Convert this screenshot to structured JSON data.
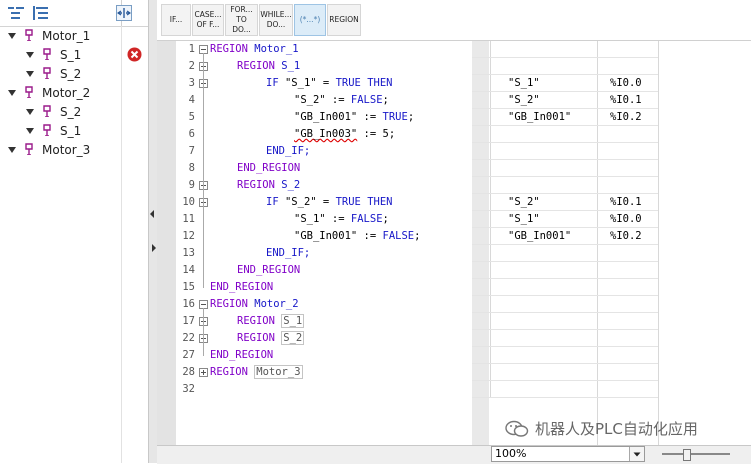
{
  "toolbar": {
    "buttons": [
      {
        "label": "IF..."
      },
      {
        "label": "CASE... OF F..."
      },
      {
        "label": "FOR... TO DO..."
      },
      {
        "label": "WHILE... DO..."
      },
      {
        "label": "(*...*)"
      },
      {
        "label": "REGION"
      }
    ]
  },
  "tree": {
    "items": [
      {
        "label": "Motor_1"
      },
      {
        "label": "S_1"
      },
      {
        "label": "S_2"
      },
      {
        "label": "Motor_2"
      },
      {
        "label": "S_2"
      },
      {
        "label": "S_1"
      },
      {
        "label": "Motor_3"
      }
    ]
  },
  "code": {
    "lines": [
      {
        "n": "1"
      },
      {
        "n": "2"
      },
      {
        "n": "3"
      },
      {
        "n": "4"
      },
      {
        "n": "5"
      },
      {
        "n": "6"
      },
      {
        "n": "7"
      },
      {
        "n": "8"
      },
      {
        "n": "9"
      },
      {
        "n": "10"
      },
      {
        "n": "11"
      },
      {
        "n": "12"
      },
      {
        "n": "13"
      },
      {
        "n": "14"
      },
      {
        "n": "15"
      },
      {
        "n": "16"
      },
      {
        "n": "17"
      },
      {
        "n": "22"
      },
      {
        "n": "27"
      },
      {
        "n": "28"
      },
      {
        "n": "32"
      }
    ],
    "t": {
      "region": "REGION",
      "end_region": "END_REGION",
      "if": "IF",
      "then": "THEN",
      "end_if": "END_IF;",
      "true": "TRUE",
      "false": "FALSE",
      "motor_1": "Motor_1",
      "motor_2": "Motor_2",
      "motor_3": "Motor_3",
      "s_1": "S_1",
      "s_2": "S_2",
      "q_s1": "\"S_1\"",
      "q_s2": "\"S_2\"",
      "q_gb1": "\"GB_In001\"",
      "q_gb3": "\"GB_In003\"",
      "eq": " = ",
      "assign": " := ",
      "semi": ";",
      "five": "5;"
    }
  },
  "xref": {
    "rows": [
      {
        "sym": "\"S_1\"",
        "addr": "%I0.0"
      },
      {
        "sym": "\"S_2\"",
        "addr": "%I0.1"
      },
      {
        "sym": "\"GB_In001\"",
        "addr": "%I0.2"
      },
      {
        "sym": "\"S_2\"",
        "addr": "%I0.1"
      },
      {
        "sym": "\"S_1\"",
        "addr": "%I0.0"
      },
      {
        "sym": "\"GB_In001\"",
        "addr": "%I0.2"
      }
    ]
  },
  "zoom": {
    "value": "100%"
  },
  "watermark": {
    "text": "机器人及PLC自动化应用"
  }
}
